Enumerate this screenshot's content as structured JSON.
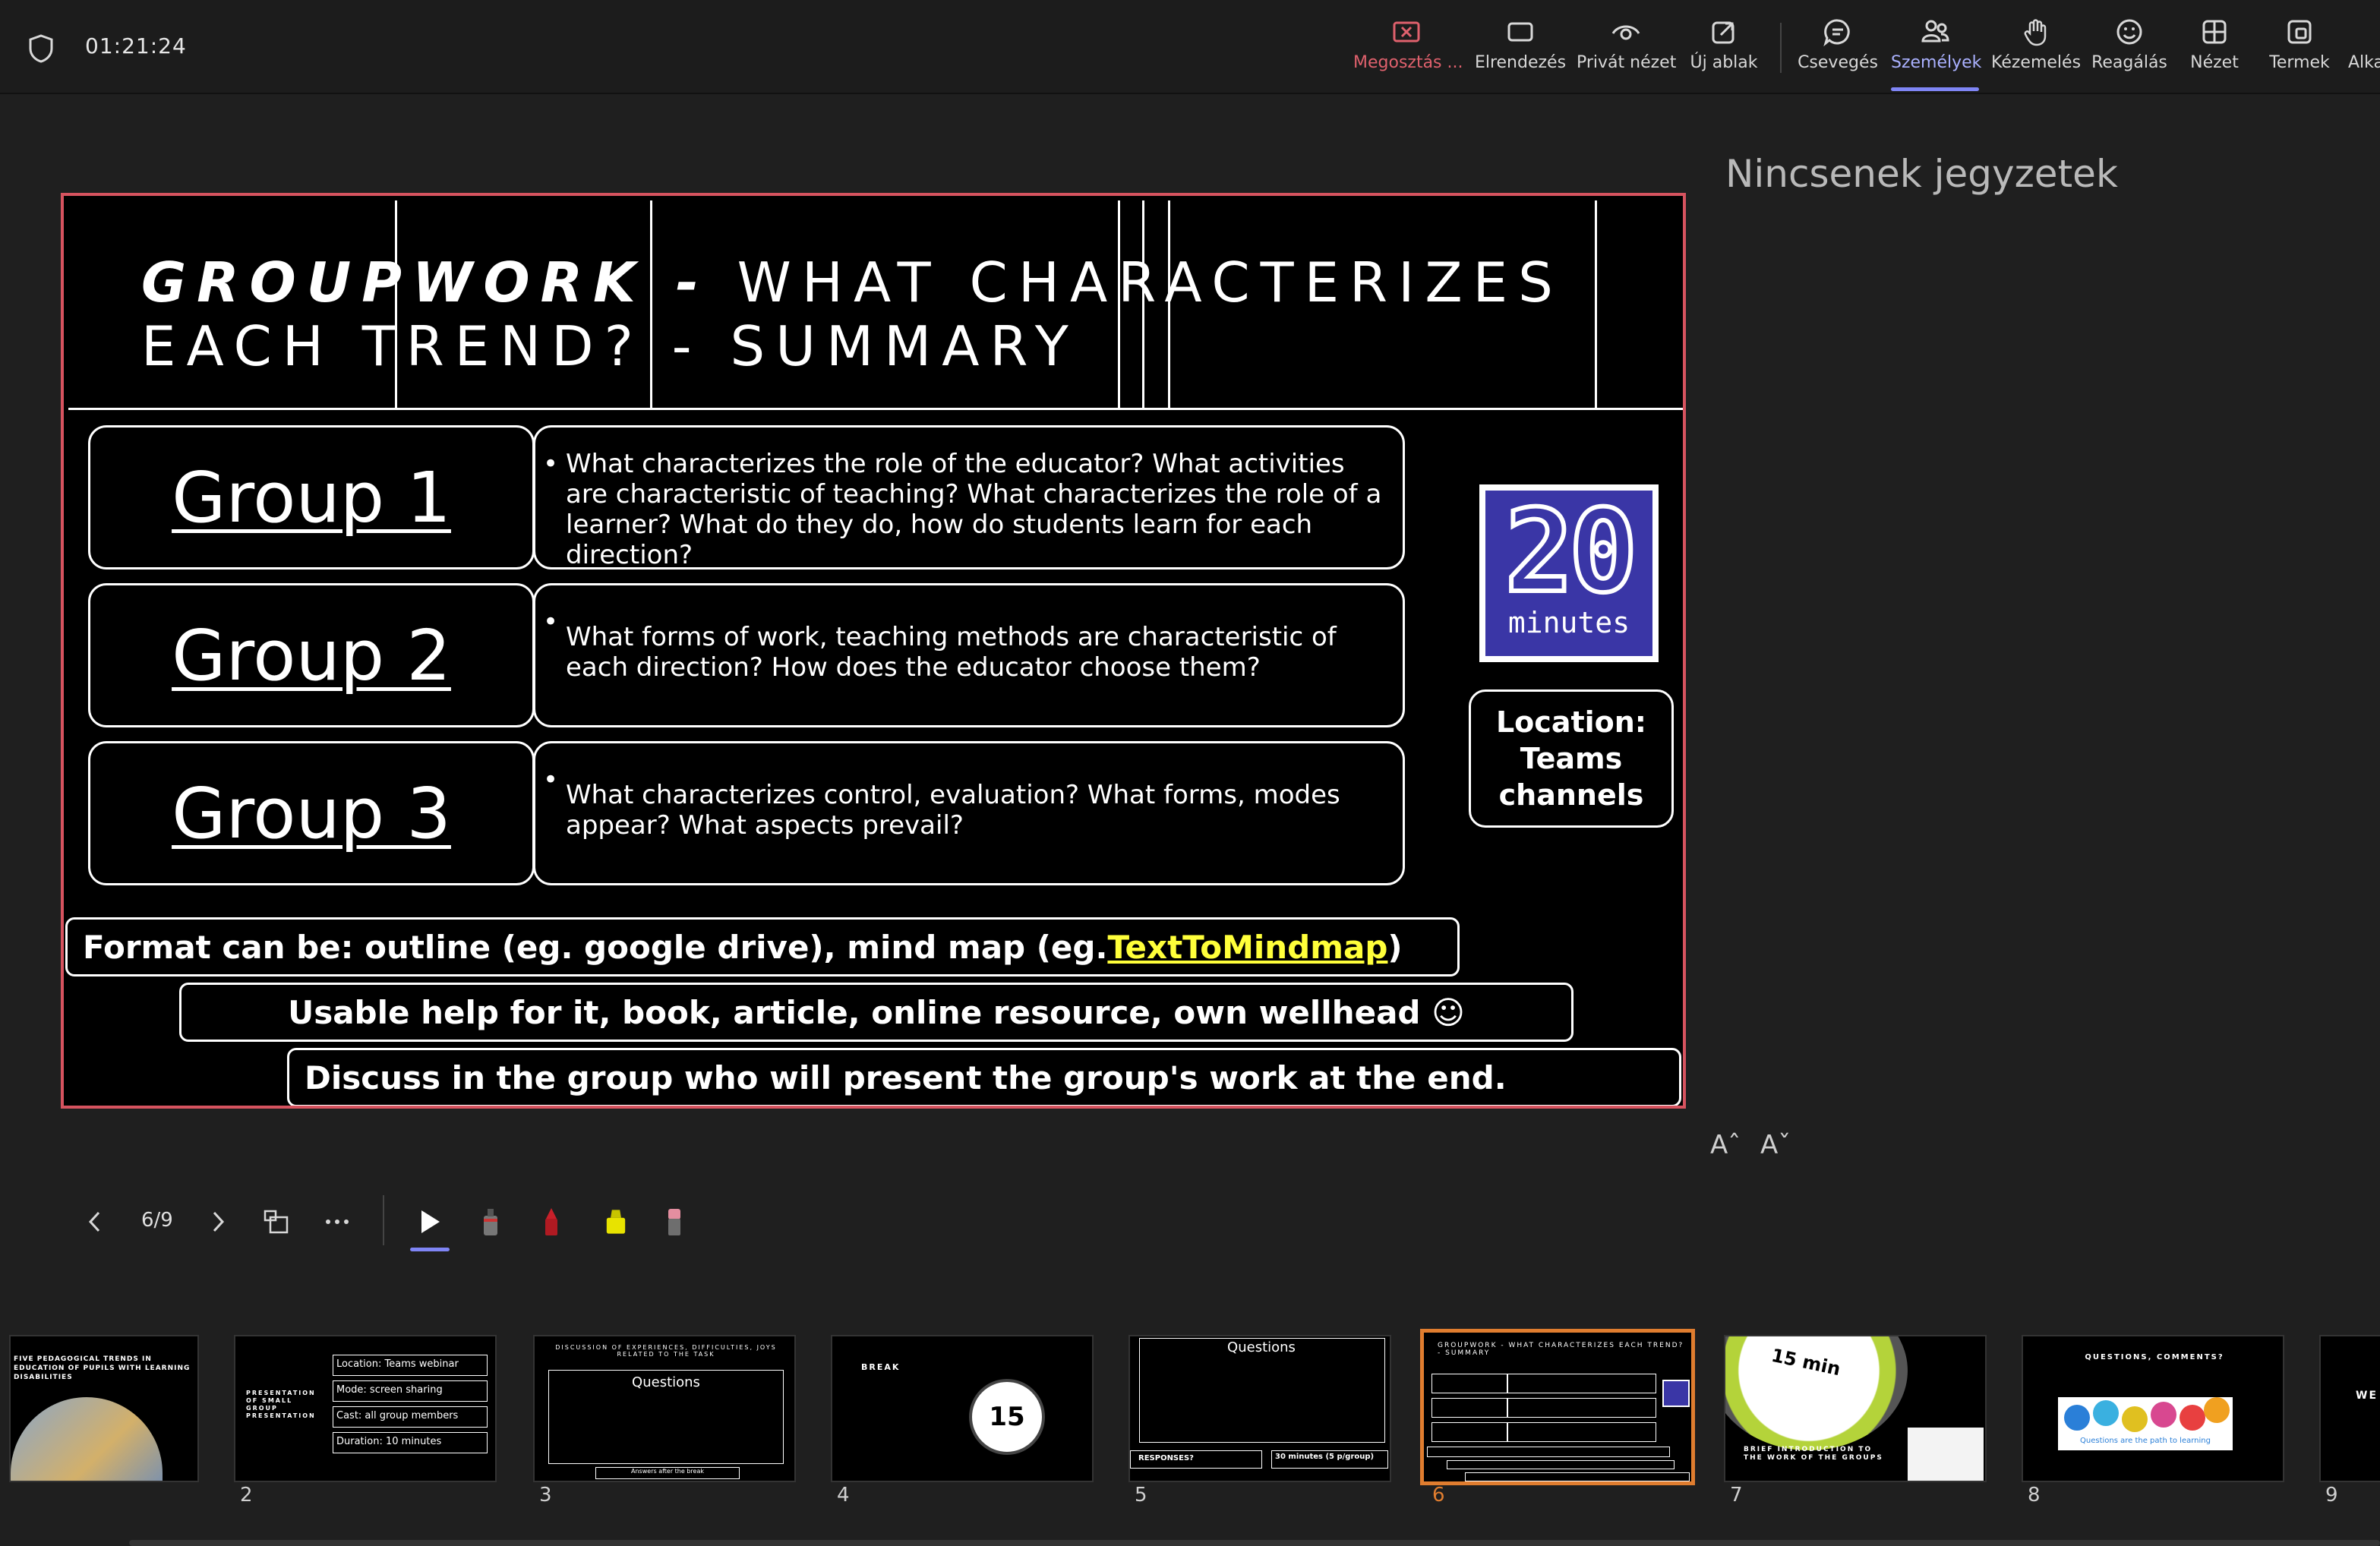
{
  "topbar": {
    "timer": "01:21:24",
    "buttons": [
      {
        "label": "Megosztás ...",
        "icon": "stop-share-icon"
      },
      {
        "label": "Elrendezés",
        "icon": "layout-icon"
      },
      {
        "label": "Privát nézet",
        "icon": "eye-icon"
      },
      {
        "label": "Új ablak",
        "icon": "new-window-icon"
      },
      {
        "label": "Csevegés",
        "icon": "chat-icon"
      },
      {
        "label": "Személyek",
        "icon": "people-icon"
      },
      {
        "label": "Kézemelés",
        "icon": "hand-icon"
      },
      {
        "label": "Reagálás",
        "icon": "emoji-icon"
      },
      {
        "label": "Nézet",
        "icon": "grid-icon"
      },
      {
        "label": "Termek",
        "icon": "rooms-icon"
      },
      {
        "label": "Alka",
        "icon": "apps-icon"
      }
    ],
    "active_button": "Személyek",
    "stop_color": "#e0616d",
    "accent_color": "#7f85f5"
  },
  "slide": {
    "title_bold": "GROUPWORK -",
    "title_rest": " WHAT CHARACTERIZES",
    "title_line2": "EACH TREND? - SUMMARY",
    "groups": [
      {
        "label": "Group 1",
        "question": "What characterizes the role of the educator? What activities are characteristic of teaching? What characterizes the role of a learner? What do they do, how do students learn for each direction?"
      },
      {
        "label": "Group 2",
        "question": "What forms of work, teaching methods are characteristic of each direction? How does the educator choose them?"
      },
      {
        "label": "Group 3",
        "question": "What characterizes control, evaluation? What forms, modes appear? What aspects prevail?"
      }
    ],
    "timer_badge": {
      "number": "20",
      "unit": "minutes"
    },
    "location_lines": [
      "Location:",
      "Teams",
      "channels"
    ],
    "format_prefix": "Format can be: outline (eg. google drive), mind map (eg. ",
    "format_link": "TextToMindmap",
    "format_suffix": ")",
    "help_line": "Usable help for it, book, article, online resource, own wellhead ☺",
    "discuss_line": "Discuss in the group who will present the group's work at the end.",
    "border_color": "#d6535f",
    "link_color": "#ffff3a"
  },
  "notes": {
    "empty_text": "Nincsenek jegyzetek",
    "font_increase": "Aˆ",
    "font_decrease": "Aˇ"
  },
  "controls": {
    "page_indicator": "6/9"
  },
  "thumbnails": [
    {
      "num": "",
      "title": "FIVE PEDAGOGICAL TRENDS IN EDUCATION OF PUPILS WITH LEARNING DISABILITIES"
    },
    {
      "num": "2",
      "title": "PRESENTATION OF SMALL GROUP PRESENTATION",
      "items": [
        "Location: Teams webinar",
        "Mode: screen sharing",
        "Cast: all group members",
        "Duration: 10 minutes"
      ]
    },
    {
      "num": "3",
      "title": "DISCUSSION OF EXPERIENCES, DIFFICULTIES, JOYS RELATED TO THE TASK",
      "heading": "Questions",
      "footer": "Answers after the break"
    },
    {
      "num": "4",
      "title": "BREAK",
      "badge": "15"
    },
    {
      "num": "5",
      "heading": "Questions",
      "footer_left": "RESPONSES?",
      "footer_right": "30 minutes (5 p/group)"
    },
    {
      "num": "6",
      "title": "GROUPWORK - WHAT CHARACTERIZES EACH TREND? - SUMMARY"
    },
    {
      "num": "7",
      "title": "BRIEF INTRODUCTION TO THE WORK OF THE GROUPS",
      "badge": "15 min"
    },
    {
      "num": "8",
      "title": "QUESTIONS, COMMENTS?",
      "caption": "Questions are the path to learning"
    },
    {
      "num": "9",
      "title": "WE"
    }
  ],
  "current_slide": "6",
  "current_color": "#e07d2f"
}
